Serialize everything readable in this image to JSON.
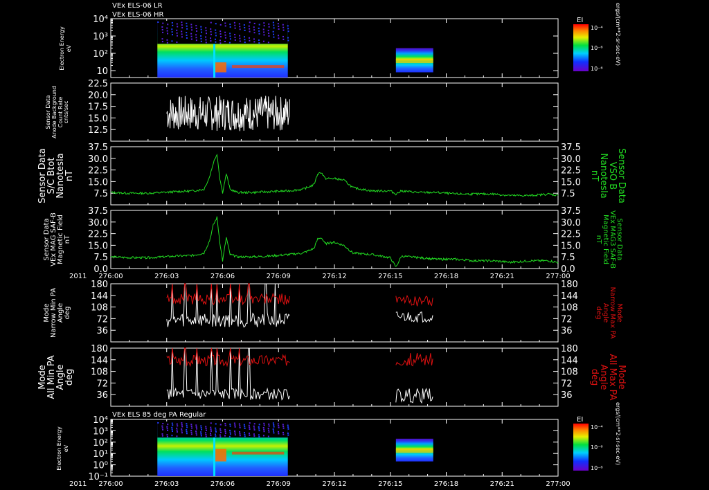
{
  "chart_data": [
    {
      "type": "heatmap",
      "panel": "p1",
      "header": [
        "VEx ELS-06 LR",
        "VEx ELS-06 HR"
      ],
      "ylabel": [
        "Electron Energy",
        "eV"
      ],
      "yscale": "log",
      "ylim": [
        4,
        10000
      ],
      "ytick_labels": [
        "10",
        "10²",
        "10³",
        "10⁴"
      ],
      "ytick_values": [
        10,
        100,
        1000,
        10000
      ],
      "colorbar": {
        "title": "EI",
        "labels": [
          "10⁻⁶",
          "10⁻⁶",
          "10⁻⁴"
        ],
        "unit": "ergs/(cm**2-sr-sec-eV)"
      },
      "data_windows": [
        [
          "276:02.5",
          "276:09.5"
        ],
        [
          "276:15.3",
          "276:17.3"
        ]
      ]
    },
    {
      "type": "line",
      "panel": "p2",
      "ylabel": [
        "Sensor Data",
        "Anode Background",
        "Count Rate",
        "cnts/sec"
      ],
      "ylim": [
        10,
        22.5
      ],
      "ytick_values": [
        12.5,
        15.0,
        17.5,
        20.0,
        22.5
      ],
      "ytick_labels": [
        "12.5",
        "15.0",
        "17.5",
        "20.0",
        "22.5"
      ],
      "color": "#ffffff",
      "x_range": [
        3.0,
        9.6
      ],
      "value_range": [
        12.0,
        20.5
      ],
      "mean": 16.0
    },
    {
      "type": "line",
      "panel": "p3",
      "ylabel_left": [
        "Sensor Data",
        "S/C Btot",
        "Nanotesla",
        "nT"
      ],
      "ylabel_right": [
        "Sensor Data",
        "VSO B",
        "Nanotesla",
        "nT"
      ],
      "ylim": [
        0,
        37.5
      ],
      "ytick_values": [
        7.5,
        15.0,
        22.5,
        30.0,
        37.5
      ],
      "ytick_labels": [
        "7.5",
        "15.0",
        "22.5",
        "30.0",
        "37.5"
      ],
      "color": "#22dd22",
      "points": [
        [
          0,
          8
        ],
        [
          1,
          7.5
        ],
        [
          2,
          7.5
        ],
        [
          2.8,
          8
        ],
        [
          3.5,
          8.5
        ],
        [
          4.4,
          9
        ],
        [
          5.0,
          10
        ],
        [
          5.3,
          18
        ],
        [
          5.5,
          27
        ],
        [
          5.7,
          33
        ],
        [
          5.85,
          17
        ],
        [
          6.0,
          8
        ],
        [
          6.2,
          20
        ],
        [
          6.4,
          10
        ],
        [
          6.8,
          8
        ],
        [
          7.5,
          8
        ],
        [
          8.5,
          8.5
        ],
        [
          9.5,
          9
        ],
        [
          10.3,
          10
        ],
        [
          10.9,
          13
        ],
        [
          11.1,
          20
        ],
        [
          11.3,
          21
        ],
        [
          11.5,
          17
        ],
        [
          12.0,
          17
        ],
        [
          12.5,
          16
        ],
        [
          13.0,
          11
        ],
        [
          13.5,
          10
        ],
        [
          14.0,
          9
        ],
        [
          14.5,
          9
        ],
        [
          15.0,
          9
        ],
        [
          15.3,
          7
        ],
        [
          15.6,
          9
        ],
        [
          16.5,
          8
        ],
        [
          17.5,
          8
        ],
        [
          18.5,
          7
        ],
        [
          19.5,
          7
        ],
        [
          20.5,
          7
        ],
        [
          21.5,
          6
        ],
        [
          22.5,
          6
        ],
        [
          23.5,
          7
        ],
        [
          24.0,
          6
        ]
      ]
    },
    {
      "type": "line",
      "panel": "p4",
      "ylabel_left": [
        "Sensor Data",
        "VEx MAG SAF-B",
        "Magnetic Field",
        "nT"
      ],
      "ylabel_right": [
        "Sensor Data",
        "VEx MAG3 SAF-B",
        "Magnetic Field",
        "nT"
      ],
      "ylim": [
        0,
        37.5
      ],
      "ytick_values": [
        0.0,
        7.5,
        15.0,
        22.5,
        30.0,
        37.5
      ],
      "ytick_labels": [
        "0.0",
        "7.5",
        "15.0",
        "22.5",
        "30.0",
        "37.5"
      ],
      "color": "#22dd22",
      "points": [
        [
          0,
          7.5
        ],
        [
          1,
          7
        ],
        [
          2,
          7
        ],
        [
          2.8,
          7.5
        ],
        [
          3.5,
          8
        ],
        [
          4.4,
          8.5
        ],
        [
          5.0,
          10
        ],
        [
          5.3,
          18
        ],
        [
          5.5,
          28
        ],
        [
          5.7,
          33
        ],
        [
          5.85,
          17
        ],
        [
          6.0,
          5
        ],
        [
          6.2,
          20
        ],
        [
          6.4,
          9
        ],
        [
          6.8,
          7.5
        ],
        [
          7.5,
          7.5
        ],
        [
          8.5,
          8
        ],
        [
          9.5,
          9
        ],
        [
          10.3,
          10
        ],
        [
          10.9,
          13
        ],
        [
          11.1,
          19
        ],
        [
          11.3,
          20
        ],
        [
          11.5,
          16
        ],
        [
          12.0,
          17
        ],
        [
          12.5,
          15
        ],
        [
          13.0,
          10
        ],
        [
          13.5,
          9.5
        ],
        [
          14.0,
          9
        ],
        [
          14.5,
          8
        ],
        [
          15.0,
          7
        ],
        [
          15.3,
          1
        ],
        [
          15.6,
          8
        ],
        [
          16.5,
          7
        ],
        [
          17.5,
          6
        ],
        [
          18.5,
          6
        ],
        [
          19.5,
          5
        ],
        [
          20.5,
          5
        ],
        [
          21.5,
          4
        ],
        [
          22.5,
          5
        ],
        [
          23.5,
          5
        ],
        [
          24.0,
          4
        ]
      ]
    },
    {
      "type": "line",
      "panel": "p5",
      "ylabel_left": [
        "Mode",
        "Narrow Min PA",
        "Angle",
        "deg"
      ],
      "ylabel_right": [
        "Mode",
        "Narrow Max PA",
        "Angle",
        "deg"
      ],
      "ylim": [
        0,
        180
      ],
      "ytick_values": [
        36,
        72,
        108,
        144,
        180
      ],
      "ytick_labels": [
        "36",
        "72",
        "108",
        "144",
        "180"
      ],
      "series": [
        {
          "role": "min",
          "color": "#ffffff",
          "windows": [
            [
              3.0,
              9.6,
              45,
              90
            ],
            [
              15.3,
              17.3,
              60,
              95
            ]
          ],
          "spikes": [
            3.3,
            4.0,
            4.6,
            5.4,
            5.7,
            6.4,
            6.9,
            7.4,
            8.3,
            8.8
          ]
        },
        {
          "role": "max",
          "color": "#dd1111",
          "windows": [
            [
              3.0,
              9.6,
              115,
              150
            ],
            [
              15.3,
              17.3,
              110,
              145
            ]
          ],
          "spikes": [
            3.3,
            4.0,
            4.6,
            5.4,
            5.7,
            6.4,
            6.9,
            7.4
          ]
        }
      ]
    },
    {
      "type": "line",
      "panel": "p6",
      "ylabel_left": [
        "Mode",
        "All Min PA",
        "Angle",
        "deg"
      ],
      "ylabel_right": [
        "Mode",
        "All Max PA",
        "Angle",
        "deg"
      ],
      "ylim": [
        0,
        180
      ],
      "ytick_values": [
        36,
        72,
        108,
        144,
        180
      ],
      "ytick_labels": [
        "36",
        "72",
        "108",
        "144",
        "180"
      ],
      "series": [
        {
          "role": "min",
          "color": "#ffffff",
          "windows": [
            [
              3.0,
              9.6,
              20,
              55
            ],
            [
              15.3,
              17.3,
              10,
              55
            ]
          ],
          "spikes": [
            3.3,
            4.0,
            4.6,
            5.4,
            5.7,
            6.4,
            6.9,
            7.4
          ]
        },
        {
          "role": "max",
          "color": "#dd1111",
          "windows": [
            [
              3.0,
              9.6,
              125,
              160
            ],
            [
              15.3,
              17.3,
              125,
              165
            ]
          ],
          "spikes": [
            3.3,
            4.0,
            4.6,
            5.4,
            5.7,
            6.4,
            6.9
          ]
        }
      ]
    },
    {
      "type": "heatmap",
      "panel": "p7",
      "header": [
        "VEx ELS 85 deg PA Regular"
      ],
      "ylabel": [
        "Electron Energy",
        "eV"
      ],
      "yscale": "log",
      "ylim": [
        0.1,
        10000
      ],
      "ytick_labels": [
        "10⁻¹",
        "10⁰",
        "10¹",
        "10²",
        "10³",
        "10⁴"
      ],
      "ytick_values": [
        0.1,
        1,
        10,
        100,
        1000,
        10000
      ],
      "colorbar": {
        "title": "EI",
        "labels": [
          "10⁻⁸",
          "10⁻⁶",
          "10⁻⁴"
        ],
        "unit": "ergs/(cm**2-sr-sec-eV)"
      },
      "data_windows": [
        [
          "276:02.5",
          "276:09.5"
        ],
        [
          "276:15.3",
          "276:17.3"
        ]
      ]
    }
  ],
  "time_axis": {
    "year": "2011",
    "xlim": [
      0,
      24
    ],
    "tick_values": [
      0,
      3,
      6,
      9,
      12,
      15,
      18,
      21,
      24
    ],
    "tick_labels": [
      "276:00",
      "276:03",
      "276:06",
      "276:09",
      "276:12",
      "276:15",
      "276:18",
      "276:21",
      "277:00"
    ]
  },
  "colors": {
    "background": "#000000",
    "frame": "#ffffff",
    "mag": "#22dd22",
    "max_pa": "#dd1111",
    "min_pa": "#ffffff"
  }
}
